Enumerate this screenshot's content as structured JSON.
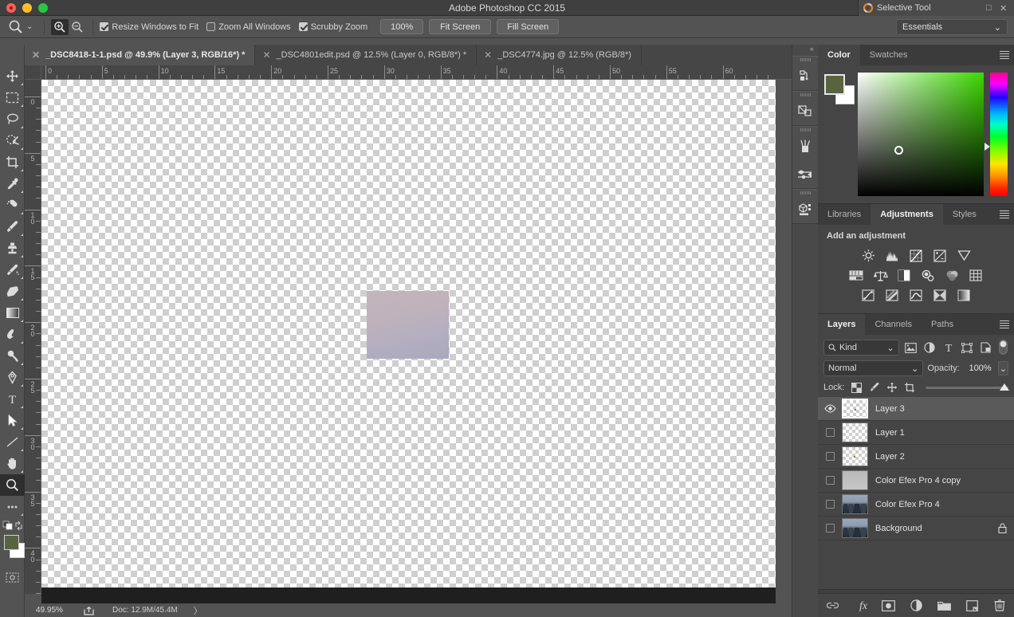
{
  "titlebar": {
    "app_title": "Adobe Photoshop CC 2015",
    "traffic_lights": [
      "close",
      "minimize",
      "zoom"
    ],
    "external_window": {
      "title": "Selective Tool",
      "icon": "nik-collection-icon",
      "maximize": "□",
      "close": "✕"
    }
  },
  "options_bar": {
    "tool_icon": "zoom-tool-icon",
    "tool_preset_chevron": "⌄",
    "zoom_in_label": "zoom-in",
    "zoom_out_label": "zoom-out",
    "checkboxes": [
      {
        "label": "Resize Windows to Fit",
        "checked": true
      },
      {
        "label": "Zoom All Windows",
        "checked": false
      },
      {
        "label": "Scrubby Zoom",
        "checked": true
      }
    ],
    "buttons": [
      "100%",
      "Fit Screen",
      "Fill Screen"
    ],
    "workspace": {
      "value": "Essentials",
      "chevron": "⌄"
    }
  },
  "tabs": [
    {
      "title": "_DSC8418-1-1.psd @ 49.9% (Layer 3, RGB/16*) *",
      "active": true,
      "close": "✕"
    },
    {
      "title": "_DSC4801edit.psd @ 12.5% (Layer 0, RGB/8*) *",
      "active": false,
      "close": "✕"
    },
    {
      "title": "_DSC4774.jpg @ 12.5% (RGB/8*)",
      "active": false,
      "close": "✕"
    }
  ],
  "toolbar": {
    "tools": [
      {
        "name": "move-tool",
        "active": false
      },
      {
        "name": "rectangular-marquee-tool",
        "active": false
      },
      {
        "name": "lasso-tool",
        "active": false
      },
      {
        "name": "quick-selection-tool",
        "active": false
      },
      {
        "name": "crop-tool",
        "active": false
      },
      {
        "name": "eyedropper-tool",
        "active": false
      },
      {
        "name": "spot-healing-brush-tool",
        "active": false
      },
      {
        "name": "brush-tool",
        "active": false
      },
      {
        "name": "clone-stamp-tool",
        "active": false
      },
      {
        "name": "history-brush-tool",
        "active": false
      },
      {
        "name": "eraser-tool",
        "active": false
      },
      {
        "name": "gradient-tool",
        "active": false
      },
      {
        "name": "blur-tool",
        "active": false
      },
      {
        "name": "dodge-tool",
        "active": false
      },
      {
        "name": "pen-tool",
        "active": false
      },
      {
        "name": "horizontal-type-tool",
        "active": false
      },
      {
        "name": "path-selection-tool",
        "active": false
      },
      {
        "name": "line-tool",
        "active": false
      },
      {
        "name": "hand-tool",
        "active": false
      },
      {
        "name": "zoom-tool",
        "active": true
      },
      {
        "name": "edit-toolbar-tool",
        "active": false
      }
    ],
    "foreground_color": "#5a6340",
    "background_color": "#ffffff",
    "quick_mask": "quick-mask-mode"
  },
  "rulers": {
    "unit_step": 5,
    "horizontal_labels": [
      "0",
      "5",
      "10",
      "15",
      "20",
      "25",
      "30",
      "35",
      "40",
      "45",
      "50",
      "55",
      "60"
    ],
    "vertical_labels": [
      "0",
      "5",
      "10",
      "15",
      "20",
      "25",
      "30",
      "35",
      "40"
    ]
  },
  "canvas": {
    "artwork_name": "gradient-rectangle",
    "artwork_colors": [
      "#c3b5bb",
      "#a9a8bd"
    ]
  },
  "statusbar": {
    "zoom": "49.95%",
    "share_icon": "share-icon",
    "doc_info": "Doc: 12.9M/45.4M",
    "expand_arrow": "〉"
  },
  "rail": {
    "collapse": "«",
    "icons": [
      "history-panel-icon",
      "layer-comps-panel-icon",
      "brush-presets-panel-icon",
      "brush-settings-panel-icon",
      "3d-panel-icon"
    ]
  },
  "color_panel": {
    "tabs": [
      {
        "label": "Color",
        "active": true
      },
      {
        "label": "Swatches",
        "active": false
      }
    ],
    "menu": "panel-menu-icon",
    "foreground": "#5a6340",
    "background": "#ffffff",
    "picker_hue": "#3cd800"
  },
  "adjustments_panel": {
    "tabs": [
      {
        "label": "Libraries",
        "active": false
      },
      {
        "label": "Adjustments",
        "active": true
      },
      {
        "label": "Styles",
        "active": false
      }
    ],
    "menu": "panel-menu-icon",
    "heading": "Add an adjustment",
    "rows": [
      [
        "brightness-contrast-icon",
        "levels-icon",
        "curves-icon",
        "exposure-icon",
        "vibrance-icon"
      ],
      [
        "hue-saturation-icon",
        "color-balance-icon",
        "black-white-icon",
        "photo-filter-icon",
        "channel-mixer-icon",
        "color-lookup-icon"
      ],
      [
        "invert-icon",
        "posterize-icon",
        "threshold-icon",
        "selective-color-icon",
        "gradient-map-icon"
      ]
    ]
  },
  "layers_panel": {
    "tabs": [
      {
        "label": "Layers",
        "active": true
      },
      {
        "label": "Channels",
        "active": false
      },
      {
        "label": "Paths",
        "active": false
      }
    ],
    "menu": "panel-menu-icon",
    "filter": {
      "label": "Kind",
      "icon": "search-icon",
      "chevron": "⌄"
    },
    "filter_icons": [
      "filter-pixel-icon",
      "filter-adjustment-icon",
      "filter-type-icon",
      "filter-shape-icon",
      "filter-smart-object-icon"
    ],
    "filter_toggle": "filter-enable-toggle",
    "blend_mode": {
      "value": "Normal",
      "chevron": "⌄"
    },
    "opacity": {
      "label": "Opacity:",
      "value": "100%",
      "chevron": "⌄"
    },
    "lock": {
      "label": "Lock:",
      "icons": [
        "lock-transparent-pixels-icon",
        "lock-image-pixels-icon",
        "lock-position-icon",
        "lock-artboard-nesting-icon"
      ]
    },
    "fill_slider": 100,
    "layers": [
      {
        "name": "Layer 3",
        "visible": true,
        "selected": true,
        "thumb": "transparent",
        "locked": false
      },
      {
        "name": "Layer 1",
        "visible": false,
        "selected": false,
        "thumb": "transparent",
        "locked": false
      },
      {
        "name": "Layer 2",
        "visible": false,
        "selected": false,
        "thumb": "transparent",
        "locked": false
      },
      {
        "name": "Color Efex Pro 4 copy",
        "visible": false,
        "selected": false,
        "thumb": "grey",
        "locked": false
      },
      {
        "name": "Color Efex Pro 4",
        "visible": false,
        "selected": false,
        "thumb": "city",
        "locked": false
      },
      {
        "name": "Background",
        "visible": false,
        "selected": false,
        "thumb": "city",
        "locked": true
      }
    ],
    "bottom_buttons": [
      "link-layers-icon",
      "add-layer-style-icon",
      "add-layer-mask-icon",
      "new-adjustment-layer-icon",
      "new-group-icon",
      "new-layer-icon",
      "delete-layer-icon"
    ]
  }
}
